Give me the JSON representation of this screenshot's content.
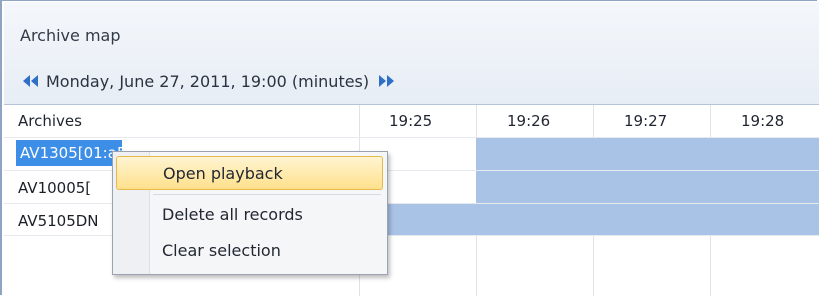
{
  "window": {
    "title": "Archive map"
  },
  "nav": {
    "date_text": "Monday, June 27, 2011, 19:00 (minutes)"
  },
  "grid": {
    "archives_header": "Archives",
    "time_columns": [
      "19:25",
      "19:26",
      "19:27",
      "19:28"
    ],
    "rows": [
      {
        "label": "AV1305[01:a5]",
        "selected": true
      },
      {
        "label": "AV10005[",
        "selected": false
      },
      {
        "label": "AV5105DN",
        "selected": false
      }
    ]
  },
  "context_menu": {
    "items": [
      {
        "label": "Open playback",
        "highlighted": true
      },
      {
        "label": "Delete all records",
        "highlighted": false
      },
      {
        "label": "Clear selection",
        "highlighted": false
      }
    ]
  },
  "colors": {
    "record_bar": "#a9c3e6",
    "selection": "#3d8ee6",
    "menu_highlight": "#ffe08c",
    "nav_arrow": "#2f6fc6"
  }
}
